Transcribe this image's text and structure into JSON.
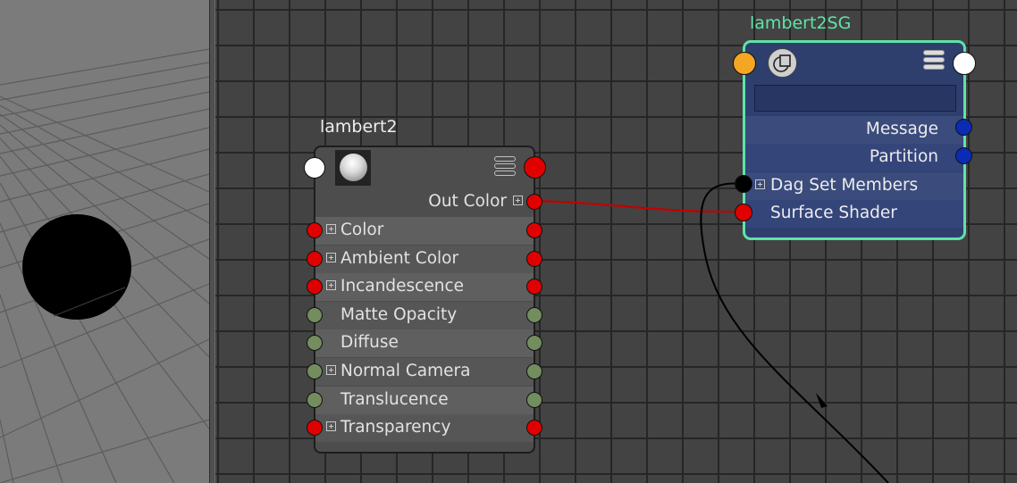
{
  "viewport": {
    "object_color": "#000000",
    "floor_color": "#7b7b7b",
    "grid_color": "#5c5c5c"
  },
  "lambert2": {
    "title": "lambert2",
    "output": {
      "label": "Out Color"
    },
    "attributes": [
      {
        "label": "Color",
        "expandable": true,
        "plug": "#e00000"
      },
      {
        "label": "Ambient Color",
        "expandable": true,
        "plug": "#e00000"
      },
      {
        "label": "Incandescence",
        "expandable": true,
        "plug": "#e00000"
      },
      {
        "label": "Matte Opacity",
        "expandable": false,
        "plug": "#738d5e"
      },
      {
        "label": "Diffuse",
        "expandable": false,
        "plug": "#738d5e"
      },
      {
        "label": "Normal Camera",
        "expandable": true,
        "plug": "#738d5e"
      },
      {
        "label": "Translucence",
        "expandable": false,
        "plug": "#738d5e"
      },
      {
        "label": "Transparency",
        "expandable": true,
        "plug": "#e00000"
      }
    ]
  },
  "shading_group": {
    "title": "lambert2SG",
    "title_color": "#5fe3a8",
    "outputs": [
      {
        "label": "Message",
        "plug": "#0b2bb5"
      },
      {
        "label": "Partition",
        "plug": "#0b2bb5"
      }
    ],
    "inputs": [
      {
        "label": "Dag Set Members",
        "expandable": true,
        "plug": "#000000"
      },
      {
        "label": "Surface Shader",
        "expandable": false,
        "plug": "#e00000"
      }
    ]
  },
  "colors": {
    "connection": "#c00000",
    "set_connection": "#000000",
    "header_left_plug": "#f5a623"
  }
}
